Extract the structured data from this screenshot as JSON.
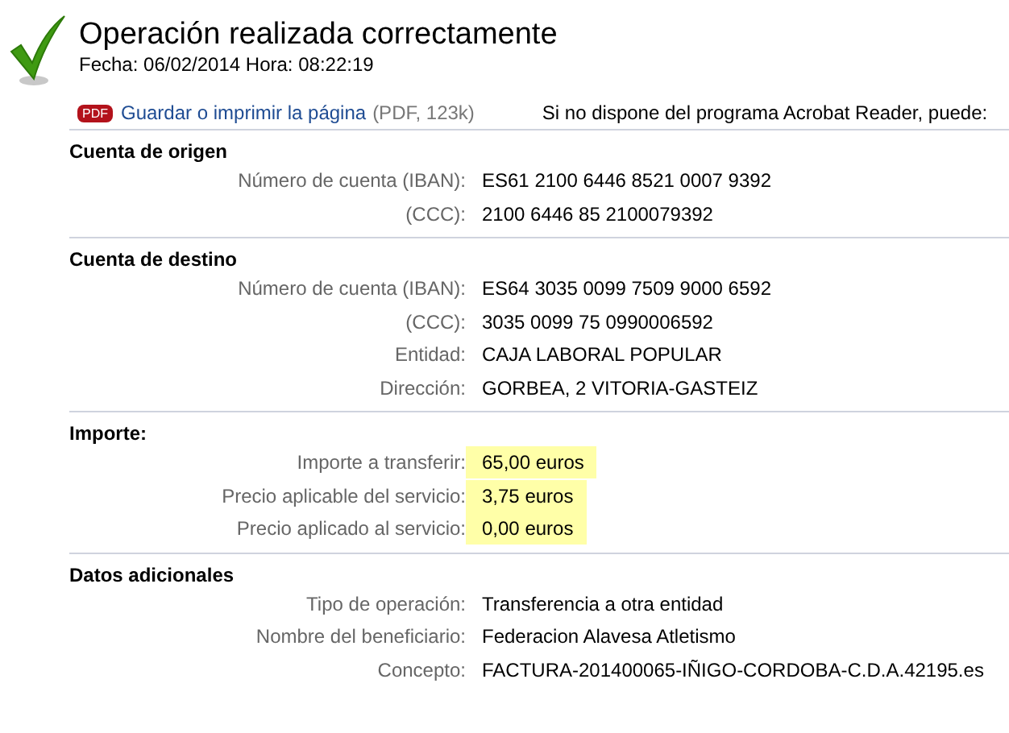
{
  "header": {
    "title": "Operación realizada correctamente",
    "datetime": "Fecha: 06/02/2014 Hora: 08:22:19",
    "pdf_badge": "PDF",
    "pdf_link": "Guardar o imprimir la página",
    "pdf_info": "(PDF, 123k)",
    "acrobat_note": "Si no dispone del programa Acrobat Reader, puede:"
  },
  "sections": [
    {
      "title": "Cuenta de origen",
      "rows": [
        {
          "label": "Número de cuenta (IBAN):",
          "value": "ES61 2100 6446 8521 0007 9392",
          "highlighted": false
        },
        {
          "label": "(CCC):",
          "value": "2100 6446 85 2100079392",
          "highlighted": false
        }
      ]
    },
    {
      "title": "Cuenta de destino",
      "rows": [
        {
          "label": "Número de cuenta (IBAN):",
          "value": "ES64 3035 0099 7509 9000 6592",
          "highlighted": false
        },
        {
          "label": "(CCC):",
          "value": "3035 0099 75 0990006592",
          "highlighted": false
        },
        {
          "label": "Entidad:",
          "value": "CAJA LABORAL POPULAR",
          "highlighted": false
        },
        {
          "label": "Dirección:",
          "value": "GORBEA, 2 VITORIA-GASTEIZ",
          "highlighted": false
        }
      ]
    },
    {
      "title": "Importe:",
      "rows": [
        {
          "label": "Importe a transferir:",
          "value": "65,00 euros",
          "highlighted": true
        },
        {
          "label": "Precio aplicable del servicio:",
          "value": "3,75 euros",
          "highlighted": true
        },
        {
          "label": "Precio aplicado al servicio:",
          "value": "0,00 euros",
          "highlighted": true
        }
      ]
    },
    {
      "title": "Datos adicionales",
      "rows": [
        {
          "label": "Tipo de operación:",
          "value": "Transferencia a otra entidad",
          "highlighted": false
        },
        {
          "label": "Nombre del beneficiario:",
          "value": "Federacion Alavesa Atletismo",
          "highlighted": false
        },
        {
          "label": "Concepto:",
          "value": "FACTURA-201400065-IÑIGO-CORDOBA-C.D.A.42195.es",
          "highlighted": false
        }
      ]
    }
  ]
}
